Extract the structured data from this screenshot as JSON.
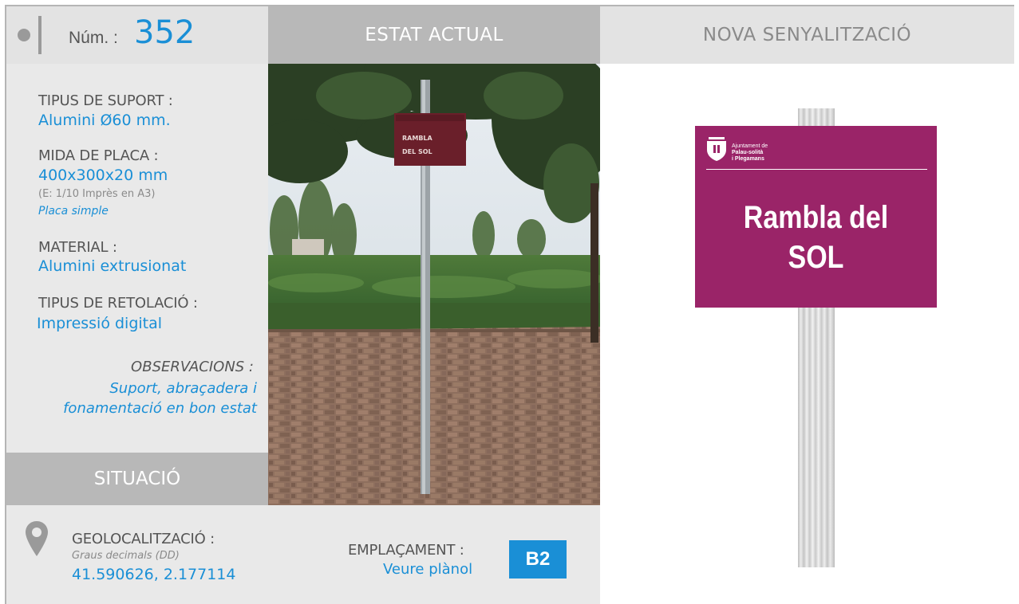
{
  "header": {
    "num_label": "Núm. :",
    "num_value": "352",
    "current_state_title": "ESTAT ACTUAL",
    "new_signage_title": "NOVA SENYALITZACIÓ"
  },
  "info": {
    "support_type_label": "TIPUS DE SUPORT :",
    "support_type_value": "Alumini Ø60 mm.",
    "plate_size_label": "MIDA DE PLACA :",
    "plate_size_value": "400x300x20 mm",
    "plate_size_scale": "(E: 1/10 Imprès en A3)",
    "plate_type": "Placa simple",
    "material_label": "MATERIAL :",
    "material_value": "Alumini extrusionat",
    "lettering_label": "TIPUS DE RETOLACIÓ :",
    "lettering_value": "Impressió digital",
    "observations_label": "OBSERVACIONS :",
    "observations_line1": "Suport, abraçadera i",
    "observations_line2": "fonamentació en bon estat"
  },
  "situation": {
    "title": "SITUACIÓ",
    "geolocation_label": "GEOLOCALITZACIÓ :",
    "geolocation_format": "Graus decimals (DD)",
    "coordinates": "41.590626, 2.177114",
    "placement_label": "EMPLAÇAMENT :",
    "placement_link": "Veure plànol",
    "placement_code": "B2"
  },
  "photo": {
    "sign_text_line1": "RAMBLA",
    "sign_text_line2": "DEL SOL"
  },
  "new_sign": {
    "org_line1": "Ajuntament de",
    "org_line2": "Palau-solità",
    "org_line3": "i Plegamans",
    "title_line1": "Rambla del",
    "title_line2": "SOL"
  },
  "colors": {
    "accent_blue": "#1a8fd6",
    "plate_magenta": "#9a2468",
    "header_grey": "#b8b8b8",
    "panel_grey": "#e9e9e9"
  }
}
